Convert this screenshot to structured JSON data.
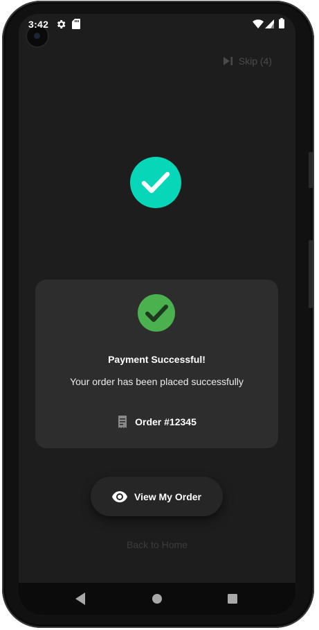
{
  "status_bar": {
    "time": "3:42",
    "icons": [
      "settings-icon",
      "sd-card-icon",
      "wifi-icon",
      "signal-icon",
      "battery-icon"
    ]
  },
  "skip": {
    "label": "Skip (4)",
    "icon": "skip-next-icon"
  },
  "success_card": {
    "title": "Payment Successful!",
    "subtitle": "Your order has been placed successfully",
    "order_label": "Order #12345",
    "order_icon": "receipt-icon"
  },
  "actions": {
    "view_order_label": "View My Order",
    "view_order_icon": "eye-icon",
    "back_home_label": "Back to Home"
  },
  "navigation": {
    "buttons": [
      "back-icon",
      "home-icon",
      "recents-icon"
    ]
  },
  "colors": {
    "accent_teal": "#08d6b9",
    "success_green": "#4bb14e",
    "screen_background": "#1d1d1d",
    "card_background": "#2d2d2d"
  }
}
